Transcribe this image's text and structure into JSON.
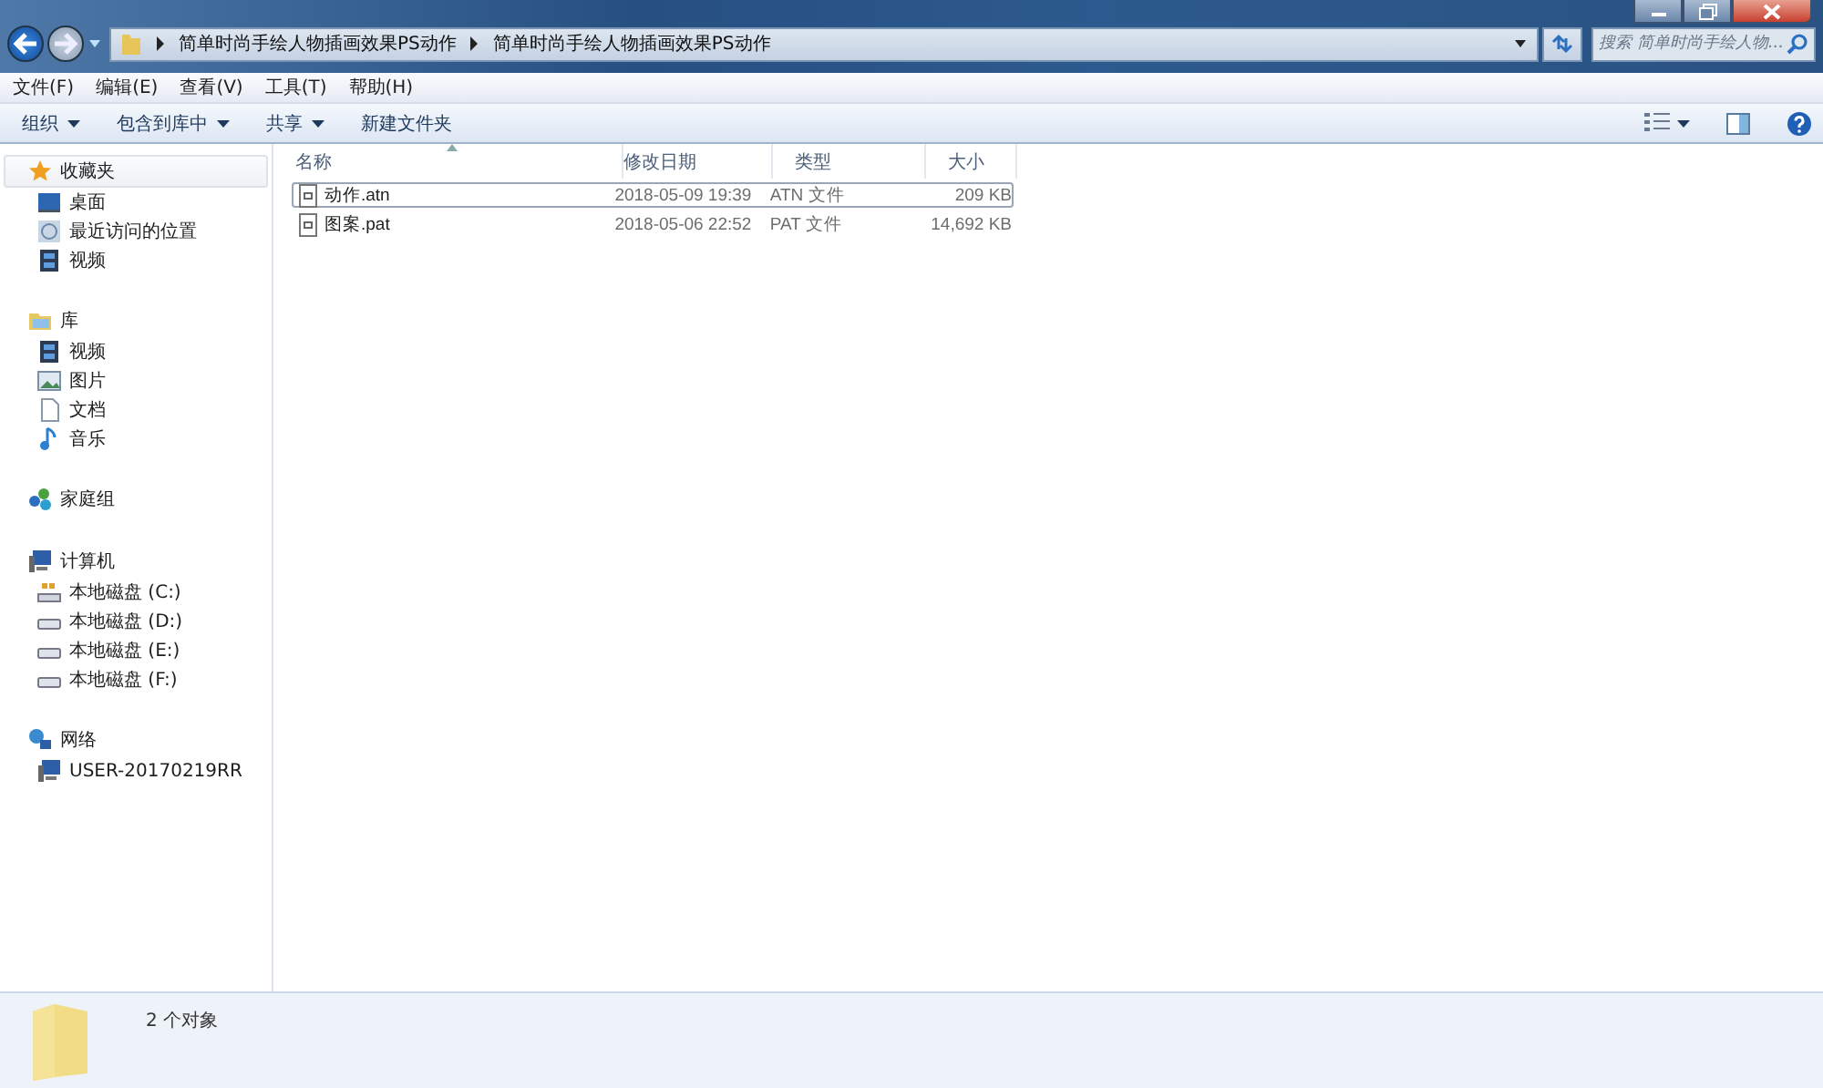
{
  "address_bar": {
    "crumbs": [
      "简单时尚手绘人物插画效果PS动作",
      "简单时尚手绘人物插画效果PS动作"
    ]
  },
  "search": {
    "placeholder": "搜索 简单时尚手绘人物..."
  },
  "menu_bar": [
    "文件(F)",
    "编辑(E)",
    "查看(V)",
    "工具(T)",
    "帮助(H)"
  ],
  "toolbar": [
    {
      "label": "组织",
      "dropdown": true
    },
    {
      "label": "包含到库中",
      "dropdown": true
    },
    {
      "label": "共享",
      "dropdown": true
    },
    {
      "label": "新建文件夹",
      "dropdown": false
    }
  ],
  "sidebar": [
    {
      "label": "收藏夹",
      "kind": "star",
      "selected": true,
      "children": [
        {
          "label": "桌面",
          "kind": "desktop"
        },
        {
          "label": "最近访问的位置",
          "kind": "recent"
        },
        {
          "label": "视频",
          "kind": "video"
        }
      ]
    },
    {
      "label": "库",
      "kind": "library",
      "selected": false,
      "children": [
        {
          "label": "视频",
          "kind": "video"
        },
        {
          "label": "图片",
          "kind": "image"
        },
        {
          "label": "文档",
          "kind": "document"
        },
        {
          "label": "音乐",
          "kind": "music"
        }
      ]
    },
    {
      "label": "家庭组",
      "kind": "homegroup",
      "selected": false
    },
    {
      "label": "计算机",
      "kind": "computer",
      "selected": false,
      "children": [
        {
          "label": "本地磁盘 (C:)",
          "kind": "system"
        },
        {
          "label": "本地磁盘 (D:)",
          "kind": "drive"
        },
        {
          "label": "本地磁盘 (E:)",
          "kind": "drive"
        },
        {
          "label": "本地磁盘 (F:)",
          "kind": "drive"
        }
      ]
    },
    {
      "label": "网络",
      "kind": "network",
      "selected": false,
      "children": [
        {
          "label": "USER-20170219RR",
          "kind": "computer"
        }
      ]
    }
  ],
  "table": {
    "columns": [
      "名称",
      "修改日期",
      "类型",
      "大小"
    ],
    "rows": [
      {
        "name": "动作.atn",
        "date": "2018-05-09 19:39",
        "type": "ATN 文件",
        "size": "209 KB",
        "focused": true
      },
      {
        "name": "图案.pat",
        "date": "2018-05-06 22:52",
        "type": "PAT 文件",
        "size": "14,692 KB",
        "focused": false
      }
    ]
  },
  "status_bar": {
    "text": "2 个对象"
  }
}
